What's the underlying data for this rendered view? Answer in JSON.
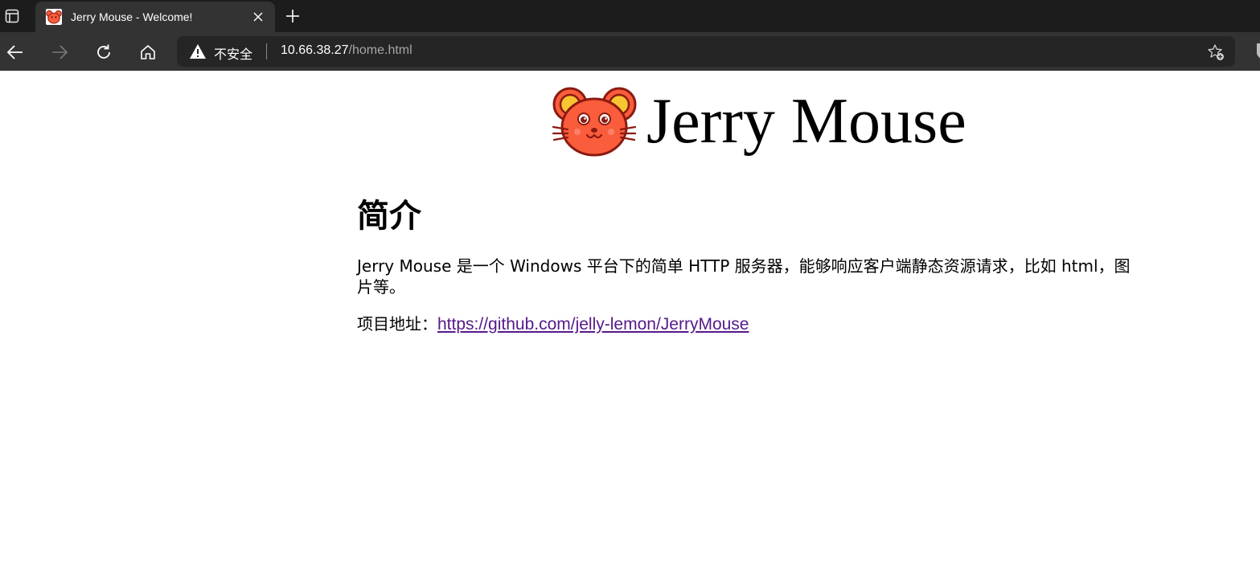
{
  "browser": {
    "tab": {
      "title": "Jerry Mouse - Welcome!"
    },
    "address_bar": {
      "security_label": "不安全",
      "url_host": "10.66.38.27",
      "url_path": "/home.html"
    },
    "icons": {
      "tab_actions": "tab-actions-icon",
      "close": "close-icon",
      "new_tab": "plus-icon",
      "back": "back-arrow-icon",
      "forward": "forward-arrow-icon",
      "reload": "reload-icon",
      "home": "home-icon",
      "warning": "warning-icon",
      "favorite": "star-add-icon"
    }
  },
  "page": {
    "logo_text": "Jerry Mouse",
    "heading": "简介",
    "intro": "Jerry Mouse 是一个 Windows 平台下的简单 HTTP 服务器，能够响应客户端静态资源请求，比如 html，图片等。",
    "project_label": "项目地址：",
    "project_link": "https://github.com/jelly-lemon/JerryMouse"
  },
  "colors": {
    "tabbar_bg": "#1c1c1c",
    "toolbar_bg": "#333333",
    "addressbar_bg": "#252525",
    "visited_link": "#551a8b",
    "mouse_face": "#f95d3c",
    "mouse_ear_inner": "#f7c531"
  }
}
